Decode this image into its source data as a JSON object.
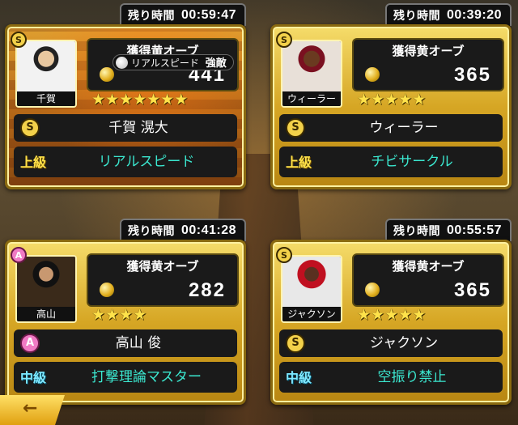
{
  "cards": [
    {
      "timer_label": "残り時間",
      "timer": "00:59:47",
      "rank": "S",
      "portrait_name": "千賀",
      "orb_title": "獲得黄オーブ",
      "orb_value": "441",
      "stars": "★★★★★★★",
      "badge": "S",
      "player_name": "千賀 滉大",
      "skill_level": "上級",
      "skill_name": "リアルスピード",
      "tag_label": "リアルスピード",
      "tag_strong": "強敵"
    },
    {
      "timer_label": "残り時間",
      "timer": "00:39:20",
      "rank": "S",
      "portrait_name": "ウィーラー",
      "orb_title": "獲得黄オーブ",
      "orb_value": "365",
      "stars": "★★★★★",
      "badge": "S",
      "player_name": "ウィーラー",
      "skill_level": "上級",
      "skill_name": "チビサークル"
    },
    {
      "timer_label": "残り時間",
      "timer": "00:41:28",
      "rank": "A",
      "portrait_name": "高山",
      "orb_title": "獲得黄オーブ",
      "orb_value": "282",
      "stars": "★★★★",
      "badge": "A",
      "player_name": "高山 俊",
      "skill_level": "中級",
      "skill_name": "打撃理論マスター"
    },
    {
      "timer_label": "残り時間",
      "timer": "00:55:57",
      "rank": "S",
      "portrait_name": "ジャクソン",
      "orb_title": "獲得黄オーブ",
      "orb_value": "365",
      "stars": "★★★★★",
      "badge": "S",
      "player_name": "ジャクソン",
      "skill_level": "中級",
      "skill_name": "空振り禁止"
    }
  ],
  "colors": {
    "panel_gold": "#d6a624",
    "skill_text": "#3be8d0",
    "star": "#ffe24a"
  }
}
